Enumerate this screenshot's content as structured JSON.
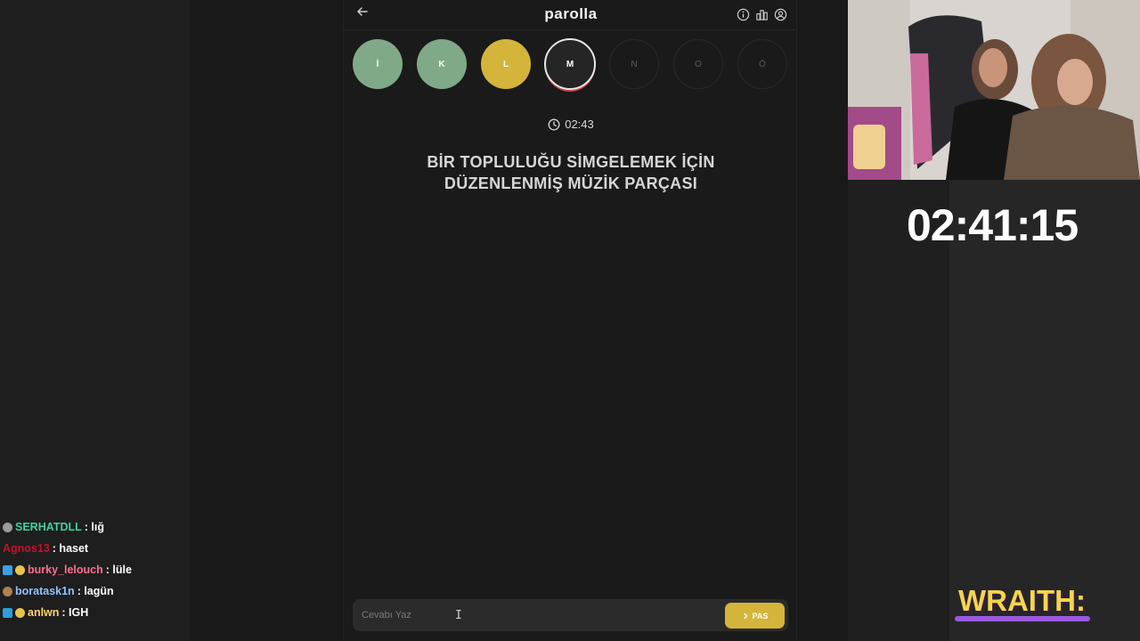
{
  "game": {
    "title": "parolla",
    "header_icons": [
      "info-icon",
      "stats-icon",
      "profile-icon"
    ],
    "letters": [
      {
        "char": "İ",
        "state": "correct"
      },
      {
        "char": "K",
        "state": "correct"
      },
      {
        "char": "L",
        "state": "passed"
      },
      {
        "char": "M",
        "state": "active"
      },
      {
        "char": "N",
        "state": "pending"
      },
      {
        "char": "O",
        "state": "pending"
      },
      {
        "char": "Ö",
        "state": "pending"
      }
    ],
    "timer": "02:43",
    "question": "BİR TOPLULUĞU SİMGELEMEK İÇİN DÜZENLENMİŞ MÜZİK PARÇASI",
    "answer_placeholder": "Cevabı Yaz",
    "pass_label": "PAS",
    "colors": {
      "correct": "#80a987",
      "passed": "#d4b43a",
      "active_ring": "#c7434b"
    }
  },
  "chat": [
    {
      "user": "SERHATDLL",
      "text": ": lığ",
      "color": "#3fd0a3"
    },
    {
      "user": "Agnos13",
      "text": ": haset",
      "color": "#c8102e"
    },
    {
      "user": "burky_lelouch",
      "text": ": lüle",
      "color": "#ff6f91"
    },
    {
      "user": "boratask1n",
      "text": ": lagün",
      "color": "#8fc3ff"
    },
    {
      "user": "anlwn",
      "text": ": IGH",
      "color": "#ffd36b"
    }
  ],
  "stream": {
    "timer": "02:41:15",
    "sponsor": "WRAITH:"
  }
}
